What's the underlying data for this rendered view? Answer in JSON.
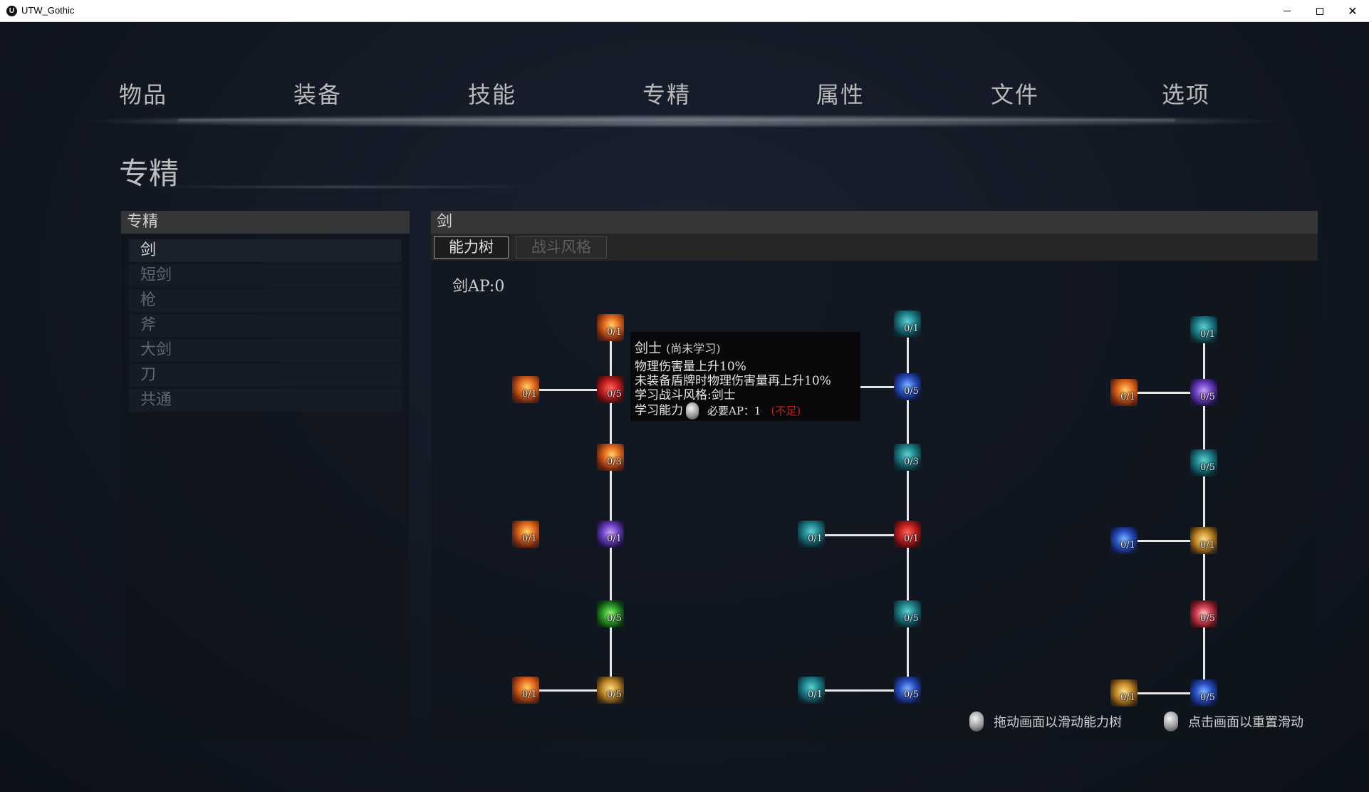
{
  "window": {
    "title": "UTW_Gothic",
    "icon": "unreal-logo-icon",
    "min": "minimize-icon",
    "max": "maximize-icon",
    "close": "close-icon"
  },
  "nav": {
    "tabs": [
      "物品",
      "装备",
      "技能",
      "专精",
      "属性",
      "文件",
      "选项"
    ]
  },
  "page": {
    "title": "专精"
  },
  "left": {
    "header": "专精",
    "items": [
      "剑",
      "短剑",
      "枪",
      "斧",
      "大剑",
      "刀",
      "共通"
    ],
    "selected": "剑"
  },
  "right": {
    "header": "剑",
    "tabs": [
      "能力树",
      "战斗风格"
    ],
    "active_tab": "能力树",
    "ap_label": "剑AP:0"
  },
  "tree": {
    "nodes": {
      "c1r0": "0/1",
      "c1r1": "0/5",
      "c1r2": "0/3",
      "c1r3": "0/1",
      "c1r4": "0/5",
      "c1r5": "0/5",
      "c0r1": "0/1",
      "c0r3": "0/1",
      "c0r5": "0/1",
      "c3r0": "0/1",
      "c3r1": "0/5",
      "c3r2": "0/3",
      "c3r3": "0/1",
      "c3r4": "0/5",
      "c3r5": "0/5",
      "c2r3": "0/1",
      "c2r5": "0/1",
      "c5r0": "0/1",
      "c5r1": "0/5",
      "c5r2": "0/5",
      "c5r3": "0/1",
      "c5r4": "0/5",
      "c5r5": "0/5",
      "c4r1": "0/1",
      "c4r3": "0/1",
      "c4r5": "0/1"
    }
  },
  "tooltip": {
    "title": "剑士",
    "status": "(尚未学习)",
    "lines": [
      "物理伤害量上升10%",
      "未装备盾牌时物理伤害量再上升10%",
      "学习战斗风格:剑士"
    ],
    "learn_label": "学习能力",
    "ap_required": "必要AP：1",
    "insufficient": "(不足)"
  },
  "hints": {
    "drag": "拖动画面以滑动能力树",
    "click": "点击画面以重置滑动"
  }
}
